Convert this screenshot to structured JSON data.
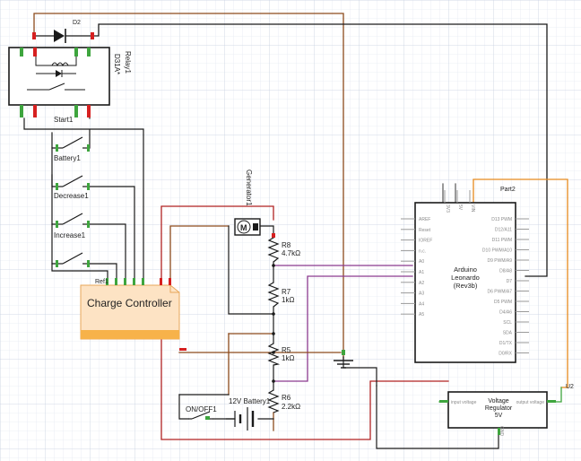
{
  "components": {
    "diode": "D2",
    "relay_name": "Relay1",
    "relay_part": "D31A*",
    "switch_start": "Start1",
    "switch_battery": "Battery1",
    "switch_decrease": "Decrease1",
    "switch_increase": "Increase1",
    "ref": "Ref1",
    "charge_controller": "Charge Controller",
    "generator": "Generator1",
    "motor_glyph": "M",
    "r8_name": "R8",
    "r8_value": "4.7kΩ",
    "r7_name": "R7",
    "r7_value": "1kΩ",
    "r5_name": "R5",
    "r5_value": "1kΩ",
    "r6_name": "R6",
    "r6_value": "2.2kΩ",
    "battery": "12V Battery1",
    "power_switch": "ON/OFF1",
    "part2": "Part2",
    "u2": "U2"
  },
  "arduino": {
    "title1": "Arduino",
    "title2": "Leonardo",
    "title3": "(Rev3b)",
    "top_pins": [
      "3V3",
      "5V",
      "VIN"
    ],
    "left_pins": [
      "AREF",
      "Reset",
      "IOREF",
      "n.c.",
      "A0",
      "A1",
      "A2",
      "A3",
      "A4",
      "A5"
    ],
    "right_pins": [
      "D13 PWM",
      "D12/A11",
      "D11 PWM",
      "D10 PWM/A10",
      "D9 PWM/A9",
      "D8/A8",
      "D7",
      "D6 PWM/A7",
      "D5 PWM",
      "D4/A6",
      "SCL",
      "SDA",
      "D1/TX",
      "D0/RX"
    ]
  },
  "regulator": {
    "title1": "Voltage",
    "title2": "Regulator",
    "title3": "5V",
    "in_label": "input voltage",
    "out_label": "output voltage",
    "gnd_label": "GND"
  },
  "colors": {
    "grid": "#dde3ee",
    "wire_black": "#1a1a1a",
    "wire_red": "#b02222",
    "wire_brown": "#8c4a1c",
    "wire_purple": "#8b3a8f",
    "wire_orange": "#e68a1e",
    "wire_gray": "#555555",
    "pin_green": "#3ea53e",
    "pin_red": "#d62020",
    "controller_fill": "#fde3c4",
    "controller_bar": "#f7b24a"
  }
}
